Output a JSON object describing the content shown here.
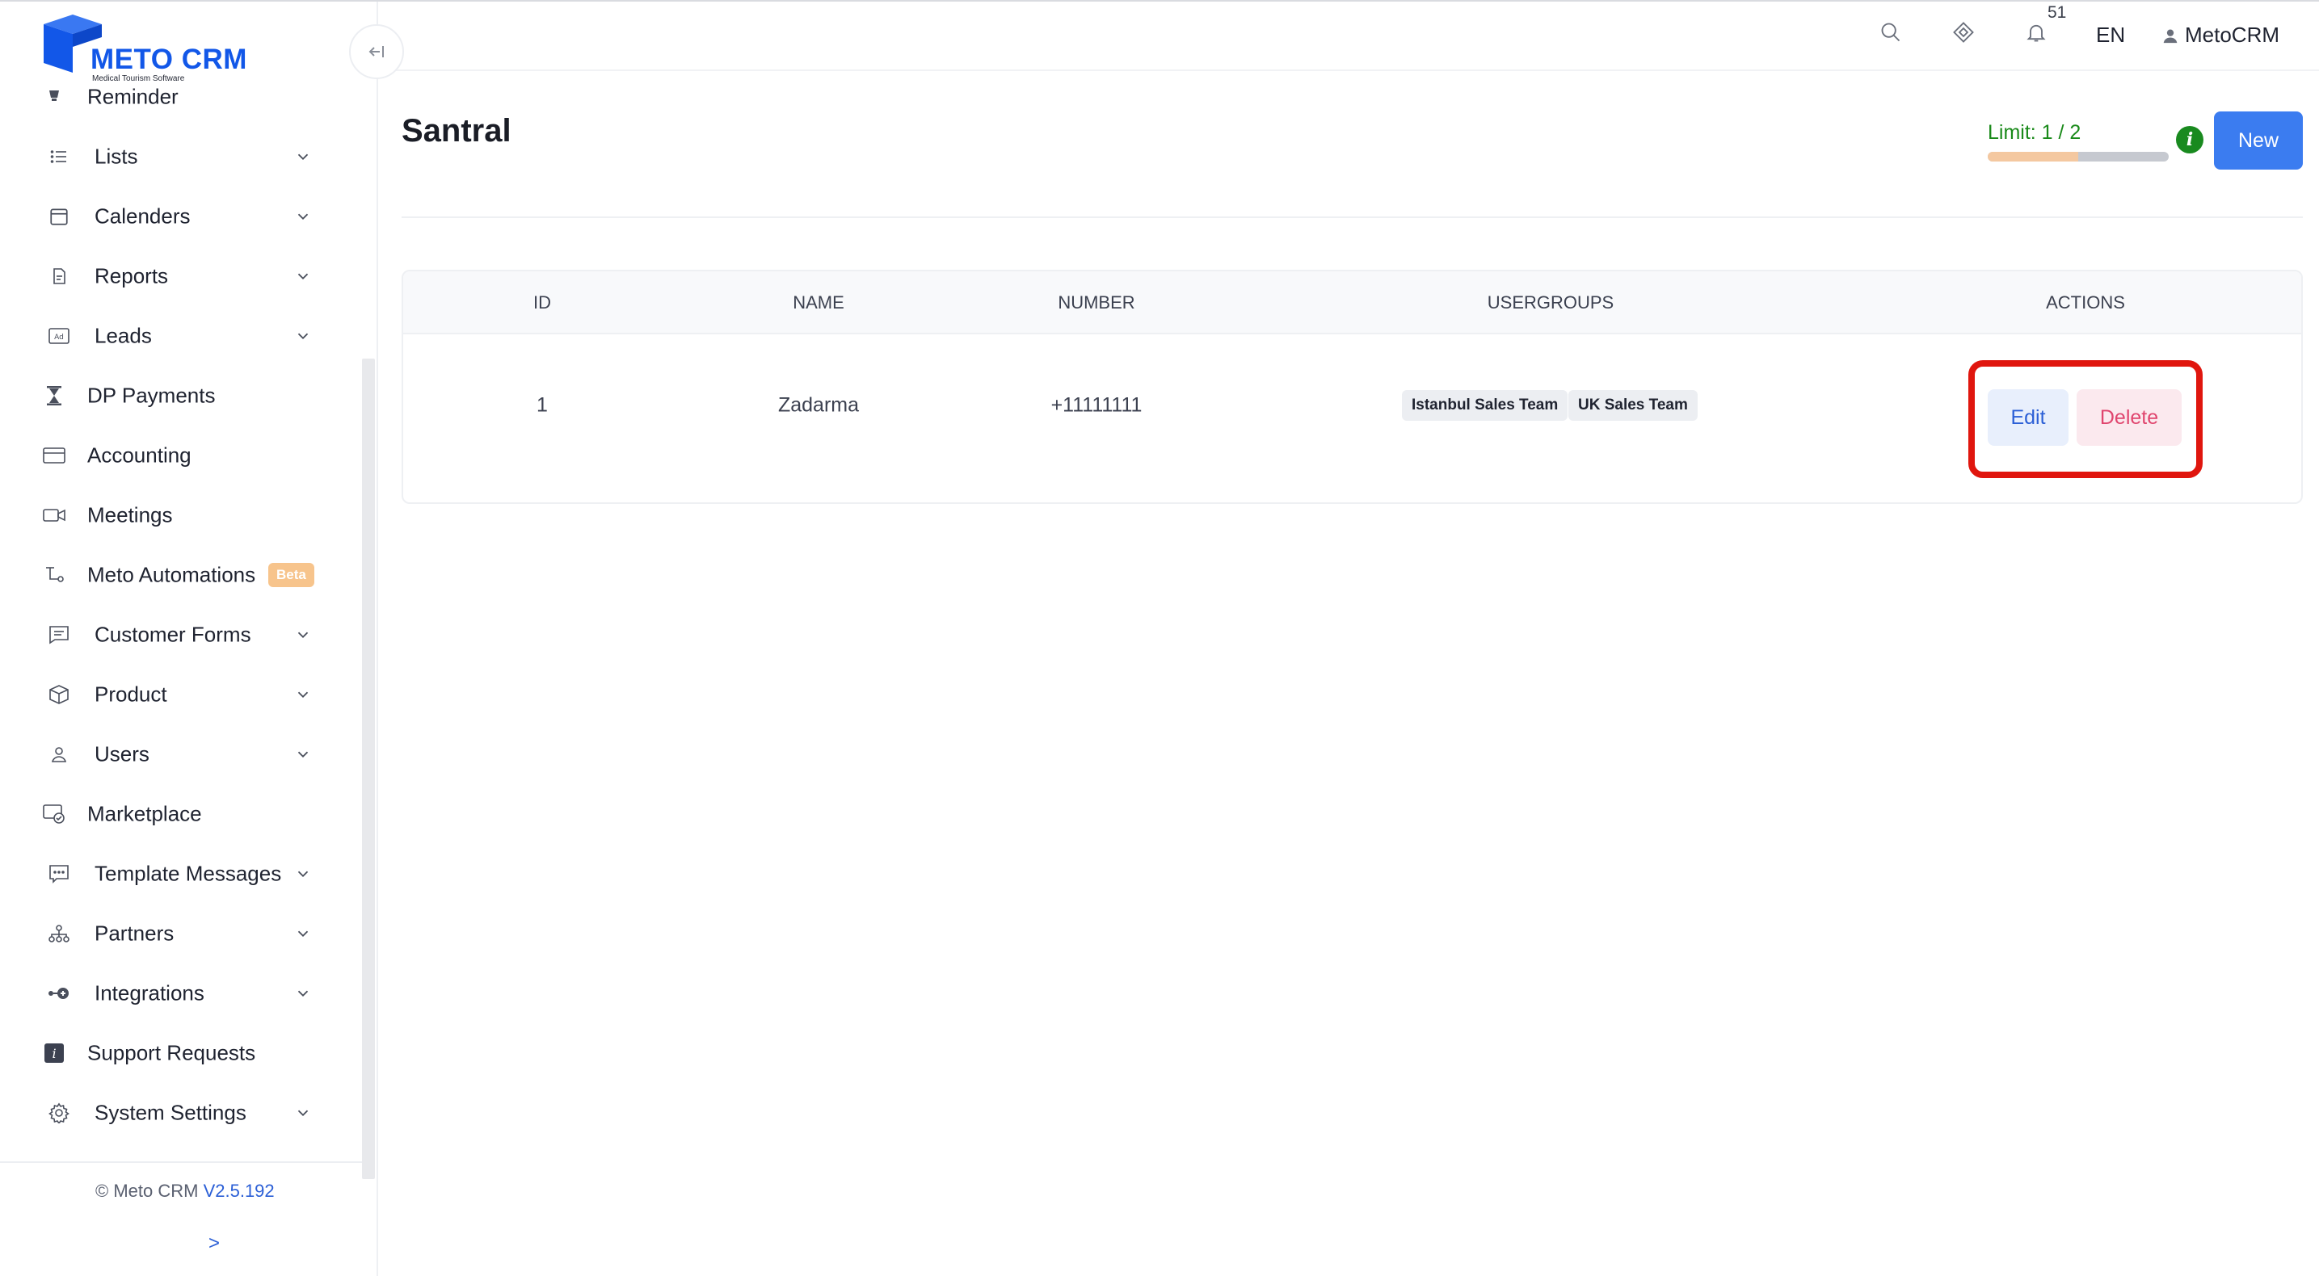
{
  "sidebar": {
    "logo": {
      "title": "METO CRM",
      "subtitle": "Medical Tourism Software"
    },
    "items": [
      {
        "label": "Reminder",
        "icon": "bell-icon"
      },
      {
        "label": "Lists",
        "icon": "list-icon"
      },
      {
        "label": "Calenders",
        "icon": "calendar-icon"
      },
      {
        "label": "Reports",
        "icon": "document-icon"
      },
      {
        "label": "Leads",
        "icon": "ad-icon"
      },
      {
        "label": "DP Payments",
        "icon": "hourglass-icon"
      },
      {
        "label": "Accounting",
        "icon": "credit-card-icon"
      },
      {
        "label": "Meetings",
        "icon": "video-icon"
      },
      {
        "label": "Meto Automations",
        "icon": "flow-icon",
        "badge": "Beta"
      },
      {
        "label": "Customer Forms",
        "icon": "forms-icon"
      },
      {
        "label": "Product",
        "icon": "box-icon"
      },
      {
        "label": "Users",
        "icon": "user-icon"
      },
      {
        "label": "Marketplace",
        "icon": "marketplace-icon"
      },
      {
        "label": "Template Messages",
        "icon": "message-icon"
      },
      {
        "label": "Partners",
        "icon": "partners-icon"
      },
      {
        "label": "Integrations",
        "icon": "integration-icon"
      },
      {
        "label": "Support Requests",
        "icon": "info-square-icon"
      },
      {
        "label": "System Settings",
        "icon": "gear-icon"
      }
    ],
    "footer": {
      "copyright": "© Meto CRM",
      "version": "V2.5.192",
      "expand": ">"
    }
  },
  "header": {
    "notification_count": "51",
    "language": "EN",
    "user_name": "MetoCRM"
  },
  "main": {
    "title": "Santral",
    "limit": {
      "label": "Limit: 1 / 2",
      "used": 1,
      "total": 2
    },
    "new_button": "New",
    "table": {
      "columns": [
        "ID",
        "NAME",
        "NUMBER",
        "USERGROUPS",
        "ACTIONS"
      ],
      "rows": [
        {
          "id": "1",
          "name": "Zadarma",
          "number": "+11111111",
          "usergroups": [
            "Istanbul Sales Team",
            "UK Sales Team"
          ],
          "actions": {
            "edit": "Edit",
            "delete": "Delete"
          }
        }
      ]
    }
  },
  "colors": {
    "brand": "#1257e8",
    "primary_button": "#3b7cf0",
    "limit_text": "#1a8a1a",
    "highlight": "#e0160e",
    "delete_text": "#e0456e"
  }
}
